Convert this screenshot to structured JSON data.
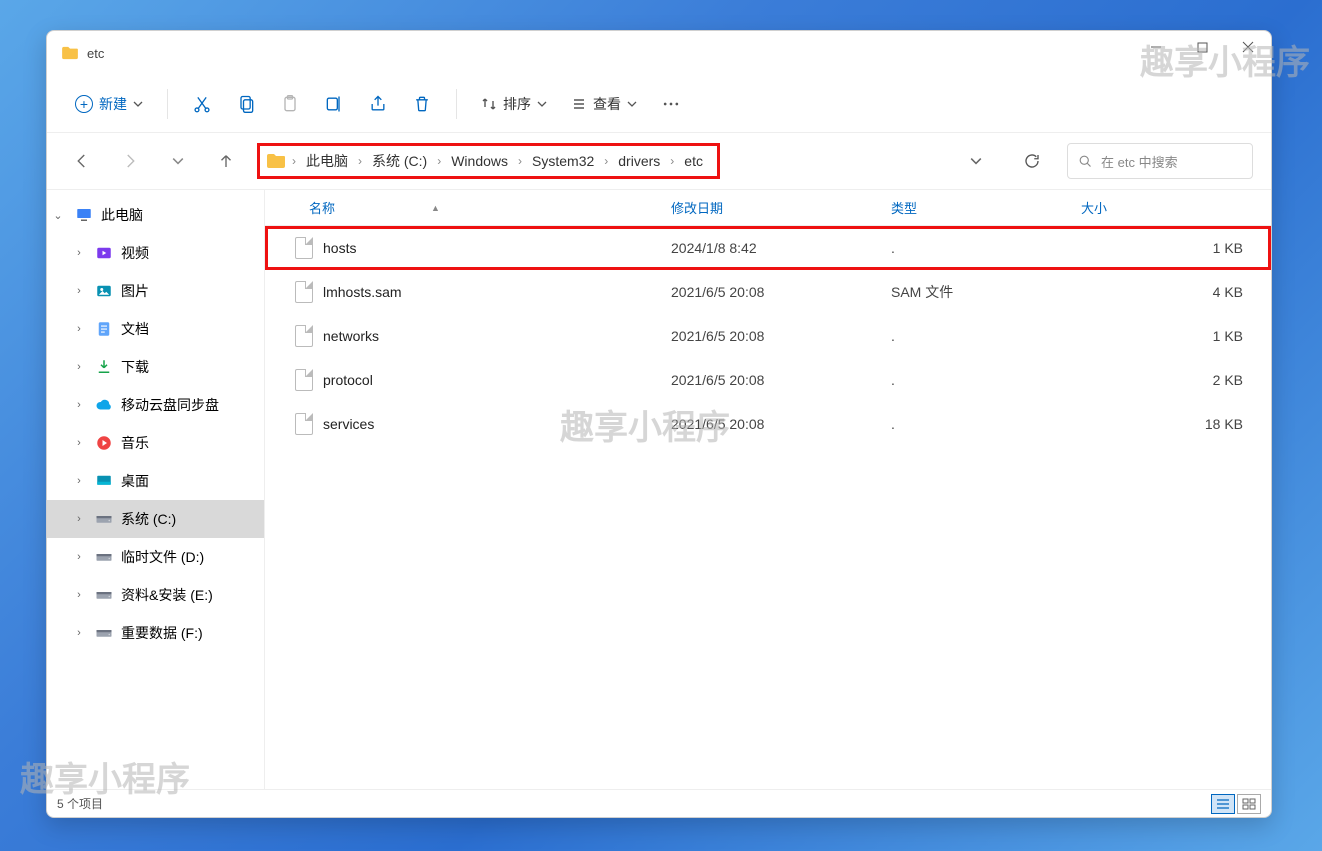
{
  "window": {
    "title": "etc"
  },
  "watermarks": [
    "趣享小程序",
    "趣享小程序",
    "趣享小程序"
  ],
  "toolbar": {
    "new_label": "新建",
    "sort_label": "排序",
    "view_label": "查看"
  },
  "breadcrumb": {
    "items": [
      "此电脑",
      "系统 (C:)",
      "Windows",
      "System32",
      "drivers",
      "etc"
    ]
  },
  "search": {
    "placeholder": "在 etc 中搜索"
  },
  "sidebar": {
    "items": [
      {
        "label": "此电脑",
        "depth": 0,
        "exp": "⌄",
        "icon": "pc",
        "sel": false
      },
      {
        "label": "视频",
        "depth": 1,
        "exp": "›",
        "icon": "video",
        "sel": false
      },
      {
        "label": "图片",
        "depth": 1,
        "exp": "›",
        "icon": "picture",
        "sel": false
      },
      {
        "label": "文档",
        "depth": 1,
        "exp": "›",
        "icon": "doc",
        "sel": false
      },
      {
        "label": "下载",
        "depth": 1,
        "exp": "›",
        "icon": "download",
        "sel": false
      },
      {
        "label": "移动云盘同步盘",
        "depth": 1,
        "exp": "›",
        "icon": "cloud",
        "sel": false
      },
      {
        "label": "音乐",
        "depth": 1,
        "exp": "›",
        "icon": "music",
        "sel": false
      },
      {
        "label": "桌面",
        "depth": 1,
        "exp": "›",
        "icon": "desktop",
        "sel": false
      },
      {
        "label": "系统 (C:)",
        "depth": 1,
        "exp": "›",
        "icon": "drive",
        "sel": true
      },
      {
        "label": "临时文件 (D:)",
        "depth": 1,
        "exp": "›",
        "icon": "drive",
        "sel": false
      },
      {
        "label": "资料&安装 (E:)",
        "depth": 1,
        "exp": "›",
        "icon": "drive",
        "sel": false
      },
      {
        "label": "重要数据 (F:)",
        "depth": 1,
        "exp": "›",
        "icon": "drive",
        "sel": false
      }
    ]
  },
  "columns": {
    "name": "名称",
    "date": "修改日期",
    "type": "类型",
    "size": "大小"
  },
  "files": [
    {
      "name": "hosts",
      "date": "2024/1/8 8:42",
      "type": ".",
      "size": "1 KB",
      "hl": true
    },
    {
      "name": "lmhosts.sam",
      "date": "2021/6/5 20:08",
      "type": "SAM 文件",
      "size": "4 KB",
      "hl": false
    },
    {
      "name": "networks",
      "date": "2021/6/5 20:08",
      "type": ".",
      "size": "1 KB",
      "hl": false
    },
    {
      "name": "protocol",
      "date": "2021/6/5 20:08",
      "type": ".",
      "size": "2 KB",
      "hl": false
    },
    {
      "name": "services",
      "date": "2021/6/5 20:08",
      "type": ".",
      "size": "18 KB",
      "hl": false
    }
  ],
  "status": {
    "count_label": "5 个项目"
  }
}
